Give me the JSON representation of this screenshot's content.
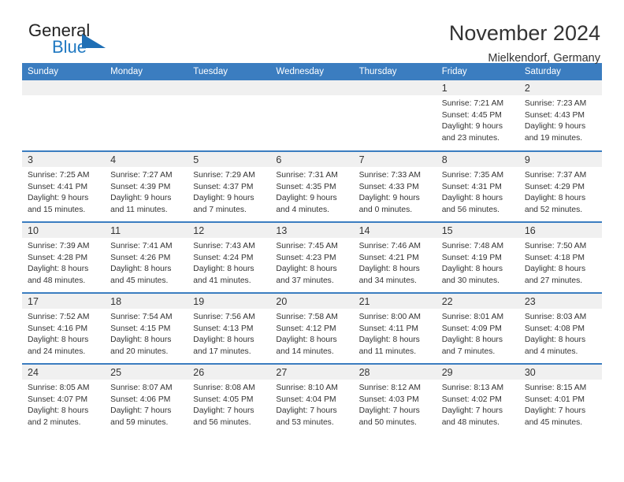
{
  "brand": {
    "name_part1": "General",
    "name_part2": "Blue",
    "triangle_color": "#1f6fb5",
    "blue_color": "#1f78c1"
  },
  "header": {
    "title": "November 2024",
    "location": "Mielkendorf, Germany"
  },
  "theme": {
    "header_bar": "#3b7dc0",
    "daynum_bg": "#f0f0f0",
    "text": "#333333"
  },
  "weekdays": [
    "Sunday",
    "Monday",
    "Tuesday",
    "Wednesday",
    "Thursday",
    "Friday",
    "Saturday"
  ],
  "weeks": [
    [
      {
        "day": "",
        "empty": true
      },
      {
        "day": "",
        "empty": true
      },
      {
        "day": "",
        "empty": true
      },
      {
        "day": "",
        "empty": true
      },
      {
        "day": "",
        "empty": true
      },
      {
        "day": "1",
        "sunrise": "Sunrise: 7:21 AM",
        "sunset": "Sunset: 4:45 PM",
        "daylight1": "Daylight: 9 hours",
        "daylight2": "and 23 minutes."
      },
      {
        "day": "2",
        "sunrise": "Sunrise: 7:23 AM",
        "sunset": "Sunset: 4:43 PM",
        "daylight1": "Daylight: 9 hours",
        "daylight2": "and 19 minutes."
      }
    ],
    [
      {
        "day": "3",
        "sunrise": "Sunrise: 7:25 AM",
        "sunset": "Sunset: 4:41 PM",
        "daylight1": "Daylight: 9 hours",
        "daylight2": "and 15 minutes."
      },
      {
        "day": "4",
        "sunrise": "Sunrise: 7:27 AM",
        "sunset": "Sunset: 4:39 PM",
        "daylight1": "Daylight: 9 hours",
        "daylight2": "and 11 minutes."
      },
      {
        "day": "5",
        "sunrise": "Sunrise: 7:29 AM",
        "sunset": "Sunset: 4:37 PM",
        "daylight1": "Daylight: 9 hours",
        "daylight2": "and 7 minutes."
      },
      {
        "day": "6",
        "sunrise": "Sunrise: 7:31 AM",
        "sunset": "Sunset: 4:35 PM",
        "daylight1": "Daylight: 9 hours",
        "daylight2": "and 4 minutes."
      },
      {
        "day": "7",
        "sunrise": "Sunrise: 7:33 AM",
        "sunset": "Sunset: 4:33 PM",
        "daylight1": "Daylight: 9 hours",
        "daylight2": "and 0 minutes."
      },
      {
        "day": "8",
        "sunrise": "Sunrise: 7:35 AM",
        "sunset": "Sunset: 4:31 PM",
        "daylight1": "Daylight: 8 hours",
        "daylight2": "and 56 minutes."
      },
      {
        "day": "9",
        "sunrise": "Sunrise: 7:37 AM",
        "sunset": "Sunset: 4:29 PM",
        "daylight1": "Daylight: 8 hours",
        "daylight2": "and 52 minutes."
      }
    ],
    [
      {
        "day": "10",
        "sunrise": "Sunrise: 7:39 AM",
        "sunset": "Sunset: 4:28 PM",
        "daylight1": "Daylight: 8 hours",
        "daylight2": "and 48 minutes."
      },
      {
        "day": "11",
        "sunrise": "Sunrise: 7:41 AM",
        "sunset": "Sunset: 4:26 PM",
        "daylight1": "Daylight: 8 hours",
        "daylight2": "and 45 minutes."
      },
      {
        "day": "12",
        "sunrise": "Sunrise: 7:43 AM",
        "sunset": "Sunset: 4:24 PM",
        "daylight1": "Daylight: 8 hours",
        "daylight2": "and 41 minutes."
      },
      {
        "day": "13",
        "sunrise": "Sunrise: 7:45 AM",
        "sunset": "Sunset: 4:23 PM",
        "daylight1": "Daylight: 8 hours",
        "daylight2": "and 37 minutes."
      },
      {
        "day": "14",
        "sunrise": "Sunrise: 7:46 AM",
        "sunset": "Sunset: 4:21 PM",
        "daylight1": "Daylight: 8 hours",
        "daylight2": "and 34 minutes."
      },
      {
        "day": "15",
        "sunrise": "Sunrise: 7:48 AM",
        "sunset": "Sunset: 4:19 PM",
        "daylight1": "Daylight: 8 hours",
        "daylight2": "and 30 minutes."
      },
      {
        "day": "16",
        "sunrise": "Sunrise: 7:50 AM",
        "sunset": "Sunset: 4:18 PM",
        "daylight1": "Daylight: 8 hours",
        "daylight2": "and 27 minutes."
      }
    ],
    [
      {
        "day": "17",
        "sunrise": "Sunrise: 7:52 AM",
        "sunset": "Sunset: 4:16 PM",
        "daylight1": "Daylight: 8 hours",
        "daylight2": "and 24 minutes."
      },
      {
        "day": "18",
        "sunrise": "Sunrise: 7:54 AM",
        "sunset": "Sunset: 4:15 PM",
        "daylight1": "Daylight: 8 hours",
        "daylight2": "and 20 minutes."
      },
      {
        "day": "19",
        "sunrise": "Sunrise: 7:56 AM",
        "sunset": "Sunset: 4:13 PM",
        "daylight1": "Daylight: 8 hours",
        "daylight2": "and 17 minutes."
      },
      {
        "day": "20",
        "sunrise": "Sunrise: 7:58 AM",
        "sunset": "Sunset: 4:12 PM",
        "daylight1": "Daylight: 8 hours",
        "daylight2": "and 14 minutes."
      },
      {
        "day": "21",
        "sunrise": "Sunrise: 8:00 AM",
        "sunset": "Sunset: 4:11 PM",
        "daylight1": "Daylight: 8 hours",
        "daylight2": "and 11 minutes."
      },
      {
        "day": "22",
        "sunrise": "Sunrise: 8:01 AM",
        "sunset": "Sunset: 4:09 PM",
        "daylight1": "Daylight: 8 hours",
        "daylight2": "and 7 minutes."
      },
      {
        "day": "23",
        "sunrise": "Sunrise: 8:03 AM",
        "sunset": "Sunset: 4:08 PM",
        "daylight1": "Daylight: 8 hours",
        "daylight2": "and 4 minutes."
      }
    ],
    [
      {
        "day": "24",
        "sunrise": "Sunrise: 8:05 AM",
        "sunset": "Sunset: 4:07 PM",
        "daylight1": "Daylight: 8 hours",
        "daylight2": "and 2 minutes."
      },
      {
        "day": "25",
        "sunrise": "Sunrise: 8:07 AM",
        "sunset": "Sunset: 4:06 PM",
        "daylight1": "Daylight: 7 hours",
        "daylight2": "and 59 minutes."
      },
      {
        "day": "26",
        "sunrise": "Sunrise: 8:08 AM",
        "sunset": "Sunset: 4:05 PM",
        "daylight1": "Daylight: 7 hours",
        "daylight2": "and 56 minutes."
      },
      {
        "day": "27",
        "sunrise": "Sunrise: 8:10 AM",
        "sunset": "Sunset: 4:04 PM",
        "daylight1": "Daylight: 7 hours",
        "daylight2": "and 53 minutes."
      },
      {
        "day": "28",
        "sunrise": "Sunrise: 8:12 AM",
        "sunset": "Sunset: 4:03 PM",
        "daylight1": "Daylight: 7 hours",
        "daylight2": "and 50 minutes."
      },
      {
        "day": "29",
        "sunrise": "Sunrise: 8:13 AM",
        "sunset": "Sunset: 4:02 PM",
        "daylight1": "Daylight: 7 hours",
        "daylight2": "and 48 minutes."
      },
      {
        "day": "30",
        "sunrise": "Sunrise: 8:15 AM",
        "sunset": "Sunset: 4:01 PM",
        "daylight1": "Daylight: 7 hours",
        "daylight2": "and 45 minutes."
      }
    ]
  ]
}
